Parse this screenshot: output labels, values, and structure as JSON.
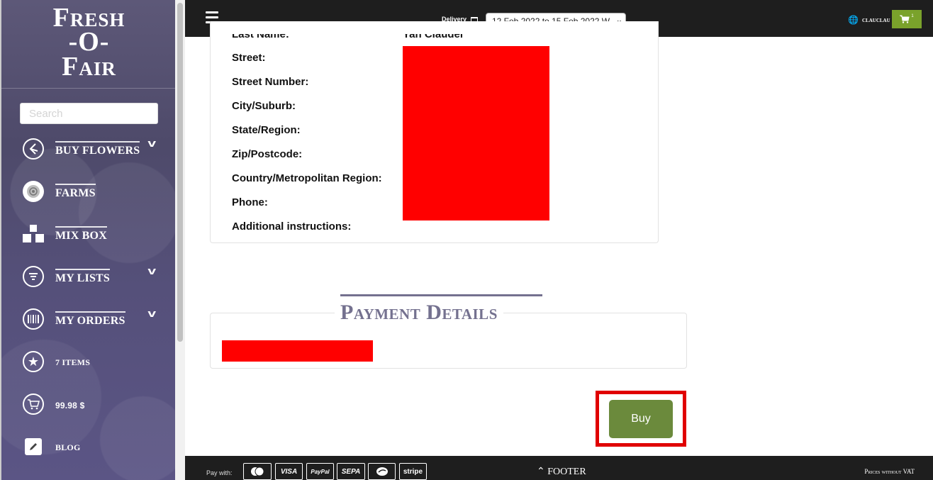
{
  "sidebar": {
    "logo": {
      "line1": "Fresh",
      "line2": "-O-",
      "line3": "Fair"
    },
    "search_placeholder": "Search",
    "items": [
      {
        "label": "BUY FLOWERS"
      },
      {
        "label": "FARMS"
      },
      {
        "label": "MIX BOX"
      },
      {
        "label": "MY LISTS"
      },
      {
        "label": "MY ORDERS"
      },
      {
        "label": "7 ITEMS"
      },
      {
        "label": "99.98 $"
      },
      {
        "label": "BLOG"
      }
    ]
  },
  "topbar": {
    "delivery_label": "Delivery",
    "delivery_value": "12 Feb 2022 to 15 Feb 2022 W",
    "username": "CLAUCLAU",
    "cart_count": "1"
  },
  "address": {
    "cut_label": "Last Name:",
    "cut_value": "Yan Claudel",
    "fields": [
      "Street:",
      "Street Number:",
      "City/Suburb:",
      "State/Region:",
      "Zip/Postcode:",
      "Country/Metropolitan Region:",
      "Phone:",
      "Additional instructions:"
    ]
  },
  "payment": {
    "heading": "Payment Details"
  },
  "actions": {
    "buy_label": "Buy"
  },
  "footer": {
    "pay_with": "Pay with:",
    "methods": [
      "mastercard",
      "VISA",
      "PayPal",
      "SEPA",
      "",
      "stripe"
    ],
    "toggle_label": "FOOTER",
    "prices_note": "Prices without VAT"
  },
  "colors": {
    "sidebar_bg": "#55507a",
    "topbar_bg": "#1e1e1e",
    "accent_green": "#6b8a3c",
    "cart_green": "#7aa22b",
    "heading_purple": "#74718f",
    "redaction": "#ff0000",
    "highlight": "#e00000"
  }
}
